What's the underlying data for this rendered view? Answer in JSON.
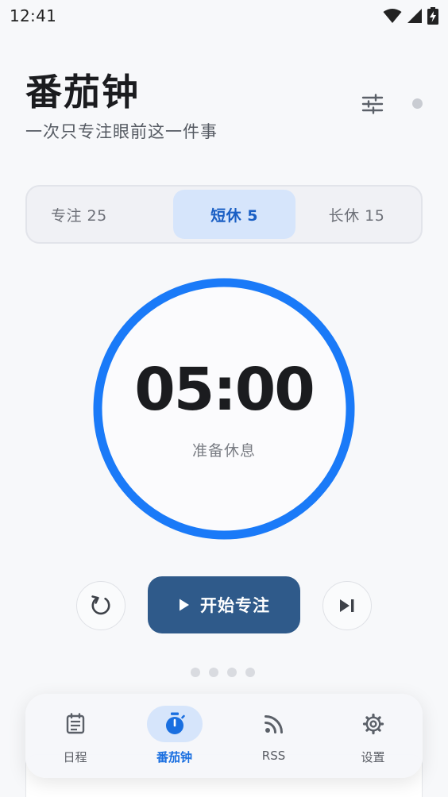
{
  "status_bar": {
    "time": "12:41"
  },
  "header": {
    "title": "番茄钟",
    "subtitle": "一次只专注眼前这一件事"
  },
  "modes": [
    {
      "label": "专注 25",
      "active": false
    },
    {
      "label": "短休 5",
      "active": true
    },
    {
      "label": "长休 15",
      "active": false
    }
  ],
  "timer": {
    "time": "05:00",
    "status": "准备休息",
    "progress": 1.0
  },
  "controls": {
    "start_label": "开始专注"
  },
  "pager": {
    "count": 4,
    "current": 0
  },
  "peek_card": {
    "text": ""
  },
  "nav": [
    {
      "label": "日程",
      "icon": "calendar-list-icon",
      "active": false
    },
    {
      "label": "番茄钟",
      "icon": "timer-icon",
      "active": true
    },
    {
      "label": "RSS",
      "icon": "rss-icon",
      "active": false
    },
    {
      "label": "设置",
      "icon": "gear-icon",
      "active": false
    }
  ],
  "colors": {
    "accent": "#1a7af8",
    "primary_button": "#2f5a8a",
    "active_tab_bg": "#d6e5fb"
  }
}
